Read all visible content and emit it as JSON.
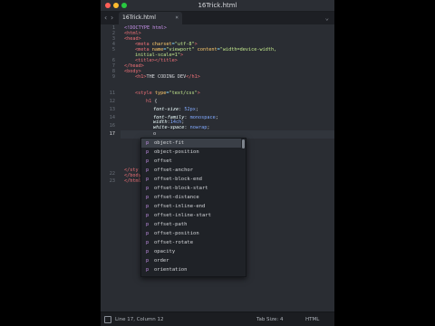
{
  "window": {
    "title": "16Trick.html",
    "traffic_colors": [
      "#ff5f57",
      "#febc2e",
      "#28c840"
    ]
  },
  "tabbar": {
    "back_icon": "chevron-left",
    "forward_icon": "chevron-right",
    "tab_label": "16Trick.html",
    "tab_close": "×",
    "tabs_menu_icon": "chevron-down"
  },
  "editor": {
    "line_numbers": [
      "1",
      "2",
      "3",
      "4",
      "5",
      "6",
      "7",
      "8",
      "9",
      "10",
      "11",
      "12",
      "13",
      "14",
      "15",
      "16",
      "17",
      "18",
      "19",
      "20",
      "21",
      "22",
      "23",
      "24"
    ],
    "current_line": "17",
    "code": {
      "l1": "<!DOCTYPE html>",
      "l2a": "<html>",
      "l3a": "<head>",
      "l4a": "<meta ",
      "l4b": "charset",
      "l4c": "=",
      "l4d": "\"utf-8\"",
      "l4e": ">",
      "l5a": "<meta ",
      "l5b": "name",
      "l5c": "=",
      "l5d": "\"viewport\"",
      "l5e": " content",
      "l5f": "=",
      "l5g": "\"width=device-width,",
      "l5h": "initial-scale=1\"",
      "l5i": ">",
      "l6": "<title></title>",
      "l7": "</head>",
      "l8": "<body>",
      "l9a": "<h1>",
      "l9b": "THE CODING DEV",
      "l9c": "</h1>",
      "l11a": "<style ",
      "l11b": "type",
      "l11c": "=",
      "l11d": "\"text/css\"",
      "l11e": ">",
      "l12a": "h1",
      "l12b": " {",
      "l13a": "font-size",
      "l13b": ": ",
      "l13c": "52px",
      "l13d": ";",
      "l14a": "font-family",
      "l14b": ": ",
      "l14c": "monospace",
      "l14d": ";",
      "l15a": "width",
      "l15c": "14ch",
      "l15d": ";",
      "l16a": "white-space",
      "l16b": ": ",
      "l16c": "nowrap",
      "l16d": ";",
      "l17": "o",
      "l22a": "</sty",
      "l22b": "le>",
      "l23": "</body>",
      "l24": "</html>"
    }
  },
  "autocomplete": {
    "icon_text": "p",
    "items": [
      "object-fit",
      "object-position",
      "offset",
      "offset-anchor",
      "offset-block-end",
      "offset-block-start",
      "offset-distance",
      "offset-inline-end",
      "offset-inline-start",
      "offset-path",
      "offset-position",
      "offset-rotate",
      "opacity",
      "order",
      "orientation"
    ]
  },
  "status": {
    "position": "Line 17, Column 12",
    "tab_size": "Tab Size: 4",
    "syntax": "HTML"
  }
}
